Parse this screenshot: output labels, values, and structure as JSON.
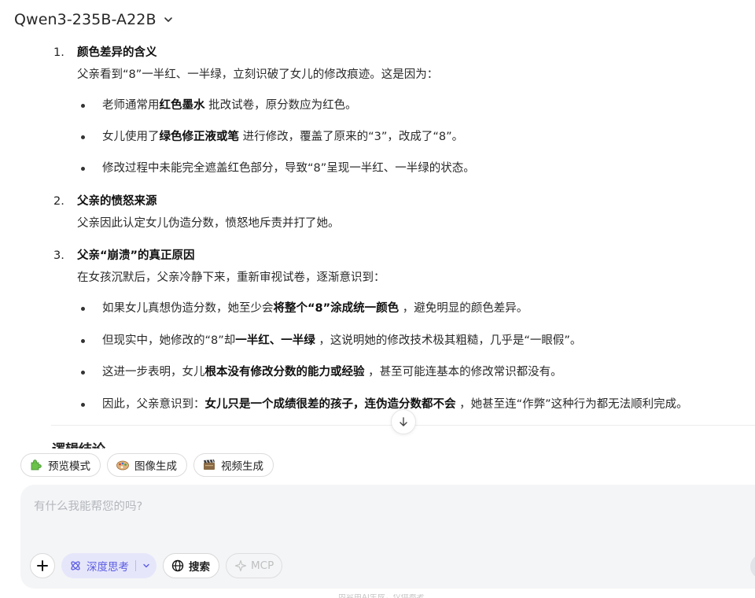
{
  "header": {
    "model_name": "Qwen3-235B-A22B"
  },
  "answer": {
    "sections": [
      {
        "num": "1.",
        "title": "颜色差异的含义",
        "text": "父亲看到“8”一半红、一半绿，立刻识破了女儿的修改痕迹。这是因为：",
        "bullets": [
          {
            "pre": "老师通常用",
            "bold": "红色墨水",
            "post": " 批改试卷，原分数应为红色。"
          },
          {
            "pre": "女儿使用了",
            "bold": "绿色修正液或笔",
            "post": " 进行修改，覆盖了原来的“3”，改成了“8”。"
          },
          {
            "text": "修改过程中未能完全遮盖红色部分，导致“8”呈现一半红、一半绿的状态。"
          }
        ]
      },
      {
        "num": "2.",
        "title": "父亲的愤怒来源",
        "text": "父亲因此认定女儿伪造分数，愤怒地斥责并打了她。"
      },
      {
        "num": "3.",
        "title": "父亲“崩溃”的真正原因",
        "text": "在女孩沉默后，父亲冷静下来，重新审视试卷，逐渐意识到：",
        "bullets": [
          {
            "pre": "如果女儿真想伪造分数，她至少会",
            "bold": "将整个“8”涂成统一颜色",
            "post": " ，避免明显的颜色差异。"
          },
          {
            "pre": "但现实中，她修改的“8”却",
            "bold": "一半红、一半绿",
            "post": " ，这说明她的修改技术极其粗糙，几乎是“一眼假”。"
          },
          {
            "pre": "这进一步表明，女儿",
            "bold": "根本没有修改分数的能力或经验",
            "post": " ，甚至可能连基本的修改常识都没有。"
          },
          {
            "pre": "因此，父亲意识到：",
            "bold": "女儿只是一个成绩很差的孩子，连伪造分数都不会",
            "post": " ，她甚至连“作弊”这种行为都无法顺利完成。"
          }
        ]
      }
    ],
    "next_heading": "逻辑结论"
  },
  "chips": [
    {
      "label": "预览模式",
      "icon": "puzzle-icon"
    },
    {
      "label": "图像生成",
      "icon": "palette-icon"
    },
    {
      "label": "视频生成",
      "icon": "film-icon"
    }
  ],
  "composer": {
    "placeholder": "有什么我能帮您的吗?",
    "think_label": "深度思考",
    "search_label": "搜索",
    "mcp_label": "MCP"
  },
  "footer": {
    "note": "内容由AI生成，仅供参考"
  },
  "colors": {
    "accent": "#5b5ce2",
    "accent_bg": "#e6e6fb"
  }
}
